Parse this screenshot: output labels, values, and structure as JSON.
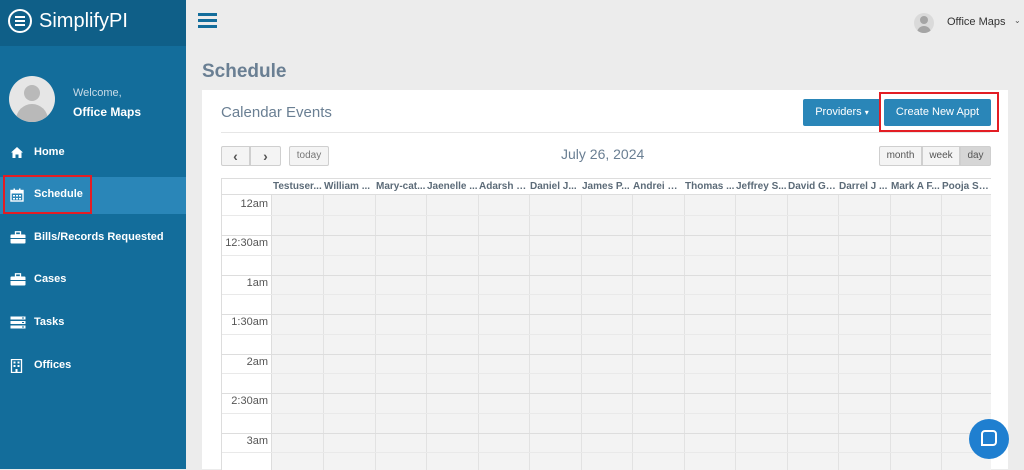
{
  "app": {
    "brand": "SimplifyPI"
  },
  "sidebar": {
    "welcome": "Welcome,",
    "user_name": "Office Maps",
    "items": [
      {
        "label": "Home",
        "icon": "home-icon",
        "active": false
      },
      {
        "label": "Schedule",
        "icon": "calendar-icon",
        "active": true
      },
      {
        "label": "Bills/Records Requested",
        "icon": "briefcase-icon",
        "active": false
      },
      {
        "label": "Cases",
        "icon": "briefcase-icon",
        "active": false
      },
      {
        "label": "Tasks",
        "icon": "server-icon",
        "active": false
      },
      {
        "label": "Offices",
        "icon": "building-icon",
        "active": false
      }
    ]
  },
  "topbar": {
    "user_name": "Office Maps",
    "caret": "⌄"
  },
  "page": {
    "title": "Schedule"
  },
  "panel": {
    "title": "Calendar Events",
    "providers_label": "Providers",
    "providers_caret": "▾",
    "create_label": "Create New Appt"
  },
  "calendar": {
    "prev": "‹",
    "next": "›",
    "today": "today",
    "date": "July 26, 2024",
    "views": {
      "month": "month",
      "week": "week",
      "day": "day"
    },
    "active_view": "day",
    "resources": [
      "Testuser...",
      "William ...",
      "Mary-cat...",
      "Jaenelle ...",
      "Adarsh S...",
      "Daniel J...",
      "James P...",
      "Andrei M...",
      "Thomas ...",
      "Jeffrey S...",
      "David Gil...",
      "Darrel J ...",
      "Mark A F...",
      "Pooja Sh..."
    ],
    "times": [
      "12am",
      "12:30am",
      "1am",
      "1:30am",
      "2am",
      "2:30am",
      "3am"
    ]
  },
  "colors": {
    "sidebar": "#136d9b",
    "sidebar_active": "#2a86b8",
    "primary_button": "#2a86b8",
    "highlight_border": "#e31d24",
    "chat_button": "#1f7fd0"
  }
}
